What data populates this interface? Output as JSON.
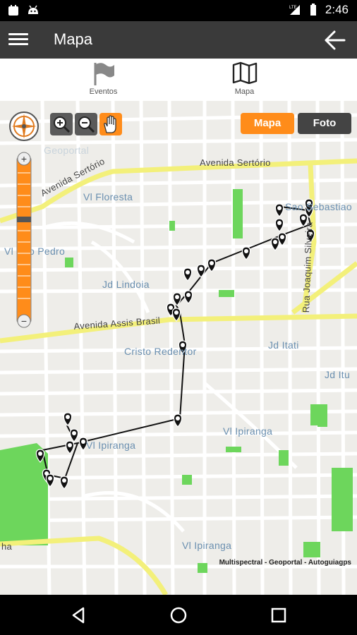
{
  "status": {
    "time": "2:46",
    "icons": [
      "notification-icon",
      "android-icon",
      "lte-signal-icon",
      "battery-icon"
    ]
  },
  "appbar": {
    "title": "Mapa"
  },
  "tabs": [
    {
      "label": "Eventos",
      "icon": "flag-icon"
    },
    {
      "label": "Mapa",
      "icon": "map-icon"
    }
  ],
  "map": {
    "mode_buttons": {
      "mapa": "Mapa",
      "foto": "Foto"
    },
    "colors": {
      "accent": "#ff8c1a",
      "route": "#111111",
      "park": "#6dd65c",
      "avenue": "#f3f07a"
    },
    "street_labels": {
      "av_sertorio": "Avenida Sertório",
      "av_sertorio_left": "Avenida Sertório",
      "av_assis": "Avenida Assis Brasil",
      "rua_joaquim": "Rua Joaquim Silveira",
      "floresta": "Vl Floresta",
      "sao_pedro": "Vl São Pedro",
      "lindoia": "Jd Lindoia",
      "cristo": "Cristo Redentor",
      "itati": "Jd Itati",
      "itu": "Jd Itu",
      "ipiranga1": "Vl Ipiranga",
      "ipiranga2": "Vl Ipiranga",
      "ipiranga3": "Vl Ipiranga",
      "sao_sebastiao": "Sao Sebastiao",
      "geoportal": "Geoportal",
      "ha": "ha"
    },
    "attribution": "Multispectral - Geoportal - Autoguiagps"
  },
  "navbar": {
    "buttons": [
      "back-nav-icon",
      "home-nav-icon",
      "recents-nav-icon"
    ]
  }
}
